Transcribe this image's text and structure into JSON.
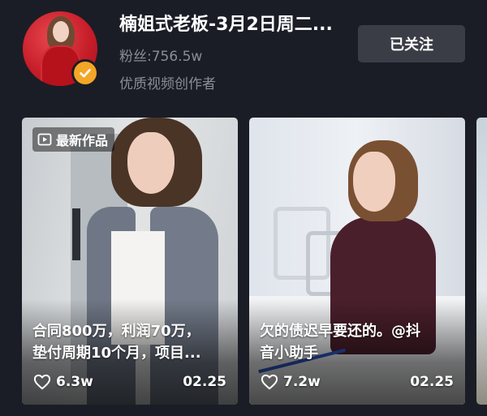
{
  "profile": {
    "name": "楠姐式老板-3月2日周二...",
    "fans": "粉丝:756.5w",
    "creator_tag": "优质视频创作者",
    "verified_color": "#f4a626",
    "follow_button": "已关注"
  },
  "videos": [
    {
      "badge": "最新作品",
      "caption_line1": "合同800万，利润70万，",
      "caption_line2": "垫付周期10个月，项目...",
      "likes": "6.3w",
      "date": "02.25"
    },
    {
      "badge": "",
      "caption_line1": "欠的债迟早要还的。@抖",
      "caption_line2": "音小助手",
      "likes": "7.2w",
      "date": "02.25"
    }
  ]
}
